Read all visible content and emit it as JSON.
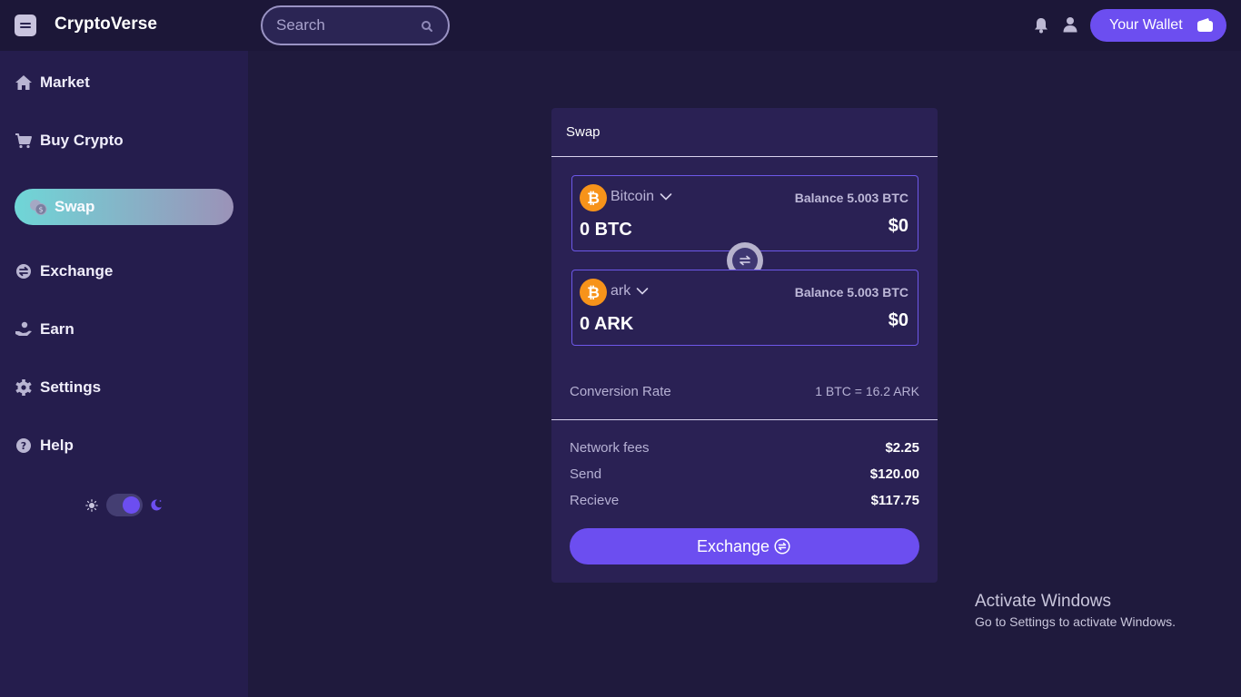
{
  "app": {
    "title": "CryptoVerse"
  },
  "header": {
    "search_placeholder": "Search",
    "wallet_label": "Your Wallet"
  },
  "sidebar": {
    "items": [
      {
        "label": "Market",
        "icon": "home-icon"
      },
      {
        "label": "Buy Crypto",
        "icon": "cart-icon"
      },
      {
        "label": "Swap",
        "icon": "coins-icon",
        "active": true
      },
      {
        "label": "Exchange",
        "icon": "exchange-icon"
      },
      {
        "label": "Earn",
        "icon": "hand-coin-icon"
      },
      {
        "label": "Settings",
        "icon": "gear-icon"
      },
      {
        "label": "Help",
        "icon": "help-icon"
      }
    ],
    "theme": "dark"
  },
  "swap": {
    "title": "Swap",
    "from": {
      "coin": "Bitcoin",
      "balance": "Balance 5.003 BTC",
      "amount": "0 BTC",
      "usd": "$0"
    },
    "to": {
      "coin": "ark",
      "balance": "Balance 5.003 BTC",
      "amount": "0 ARK",
      "usd": "$0"
    },
    "rate_label": "Conversion Rate",
    "rate_value": "1 BTC = 16.2 ARK",
    "fees": [
      {
        "label": "Network fees",
        "value": "$2.25"
      },
      {
        "label": "Send",
        "value": "$120.00"
      },
      {
        "label": "Recieve",
        "value": "$117.75"
      }
    ],
    "button_label": "Exchange"
  },
  "watermark": {
    "line1": "Activate Windows",
    "line2": "Go to Settings to activate Windows."
  },
  "colors": {
    "background": "#1f1a3d",
    "sidebar": "#251d4d",
    "accent": "#6c4ef0",
    "bitcoin": "#f7931a",
    "active_gradient_start": "#6fd6d7",
    "active_gradient_end": "#9b92b8"
  }
}
